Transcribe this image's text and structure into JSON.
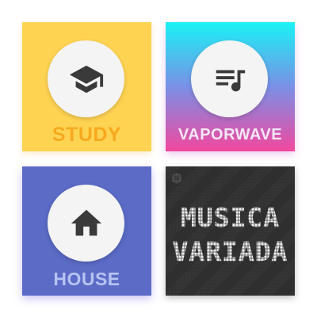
{
  "tiles": [
    {
      "label": "STUDY",
      "icon": "graduation-cap-icon",
      "background": "#FFD352",
      "label_color": "#F7A91E"
    },
    {
      "label": "VAPORWAVE",
      "icon": "playlist-music-icon",
      "background_gradient": [
        "#1AF2F5",
        "#7A90E6",
        "#F2489E"
      ],
      "label_color": "#F4E6F7"
    },
    {
      "label": "HOUSE",
      "icon": "home-icon",
      "background": "#5B6BC6",
      "label_color": "#B7C3F2"
    },
    {
      "title_line1": "MUSICA",
      "title_line2": "VARIADA",
      "icon": "spotify-icon",
      "background": "#2F2F2F",
      "label_color": "#F2F2F2"
    }
  ],
  "colors": {
    "icon_circle": "#F4F4F4",
    "icon_glyph": "#3A3A3A"
  }
}
